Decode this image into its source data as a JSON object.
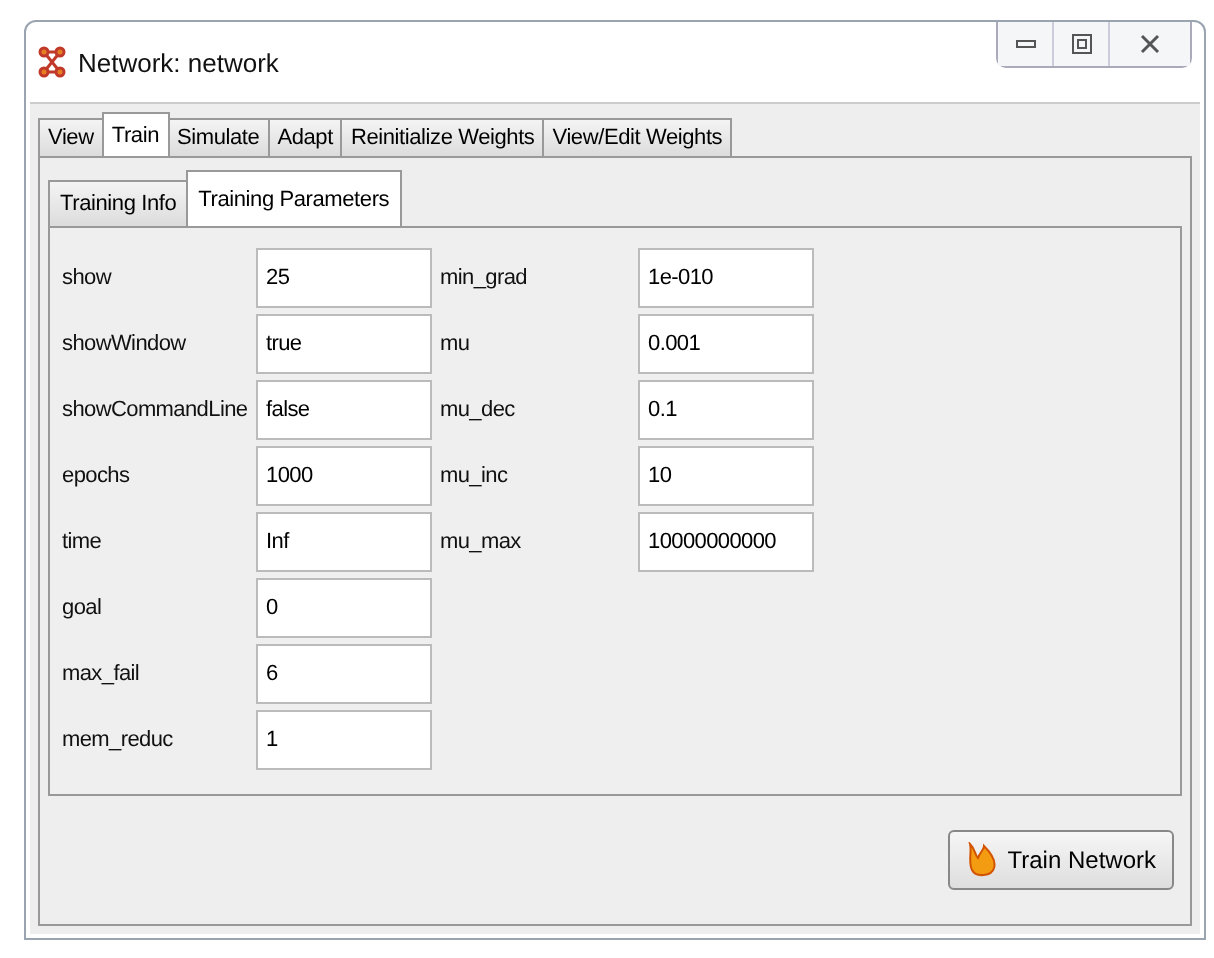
{
  "window": {
    "title": "Network: network"
  },
  "tabs": [
    {
      "label": "View",
      "selected": false
    },
    {
      "label": "Train",
      "selected": true
    },
    {
      "label": "Simulate",
      "selected": false
    },
    {
      "label": "Adapt",
      "selected": false
    },
    {
      "label": "Reinitialize Weights",
      "selected": false
    },
    {
      "label": "View/Edit Weights",
      "selected": false
    }
  ],
  "subtabs": [
    {
      "label": "Training Info",
      "selected": false
    },
    {
      "label": "Training Parameters",
      "selected": true
    }
  ],
  "parameter_columns": [
    [
      {
        "label": "show",
        "value": "25"
      },
      {
        "label": "showWindow",
        "value": "true"
      },
      {
        "label": "showCommandLine",
        "value": "false"
      },
      {
        "label": "epochs",
        "value": "1000"
      },
      {
        "label": "time",
        "value": "Inf"
      },
      {
        "label": "goal",
        "value": "0"
      },
      {
        "label": "max_fail",
        "value": "6"
      },
      {
        "label": "mem_reduc",
        "value": "1"
      }
    ],
    [
      {
        "label": "min_grad",
        "value": "1e-010"
      },
      {
        "label": "mu",
        "value": "0.001"
      },
      {
        "label": "mu_dec",
        "value": "0.1"
      },
      {
        "label": "mu_inc",
        "value": "10"
      },
      {
        "label": "mu_max",
        "value": "10000000000"
      }
    ]
  ],
  "action_button": {
    "label": "Train Network"
  }
}
